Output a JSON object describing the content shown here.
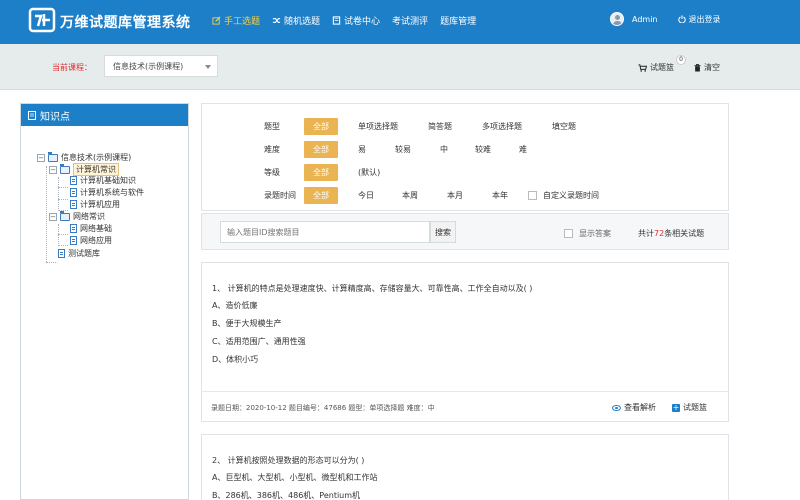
{
  "header": {
    "app_title": "万维试题库管理系统",
    "nav": [
      {
        "label": "手工选题",
        "icon": "edit-icon",
        "active": true
      },
      {
        "label": "随机选题",
        "icon": "shuffle-icon",
        "active": false
      },
      {
        "label": "试卷中心",
        "icon": "book-icon",
        "active": false
      },
      {
        "label": "考试测评",
        "icon": "",
        "active": false
      },
      {
        "label": "题库管理",
        "icon": "",
        "active": false
      }
    ],
    "user": "Admin",
    "logout": "退出登录"
  },
  "subbar": {
    "course_label": "当前课程：",
    "course_value": "信息技术(示例课程)",
    "basket_label": "试题篮",
    "basket_count": "0",
    "clear_label": "清空"
  },
  "knowledge": {
    "title": "知识点",
    "tree": [
      {
        "label": "信息技术(示例课程)"
      },
      {
        "label": "计算机常识"
      },
      {
        "label": "计算机基础知识"
      },
      {
        "label": "计算机系统与软件"
      },
      {
        "label": "计算机应用"
      },
      {
        "label": "网络常识"
      },
      {
        "label": "网络基础"
      },
      {
        "label": "网络应用"
      },
      {
        "label": "测试题库"
      }
    ]
  },
  "filters": {
    "type": {
      "label": "题型",
      "all": "全部",
      "options": [
        "单项选择题",
        "简答题",
        "多项选择题",
        "填空题"
      ]
    },
    "difficulty": {
      "label": "难度",
      "all": "全部",
      "options": [
        "易",
        "较易",
        "中",
        "较难",
        "难"
      ]
    },
    "level": {
      "label": "等级",
      "all": "全部",
      "options": [
        "(默认)"
      ]
    },
    "time": {
      "label": "录题时间",
      "all": "全部",
      "options": [
        "今日",
        "本周",
        "本月",
        "本年"
      ],
      "custom": "自定义录题时间"
    }
  },
  "search": {
    "placeholder": "输入题目ID搜索题目",
    "button": "搜索",
    "show_answer": "显示答案",
    "total_prefix": "共计",
    "total_count": "72",
    "total_suffix": "条相关试题"
  },
  "questions": [
    {
      "stem": "1、 计算机的特点是处理速度快、计算精度高、存储容量大、可靠性高、工作全自动以及(      )",
      "options": [
        "A、造价低廉",
        "B、便于大规模生产",
        "C、适用范围广、通用性强",
        "D、体积小巧"
      ],
      "meta": "录题日期：2020-10-12   题目编号：47686   题型：单项选择题   难度：中",
      "view_label": "查看解析",
      "add_label": "试题篮"
    },
    {
      "stem": "2、 计算机按照处理数据的形态可以分为(      )",
      "options": [
        "A、巨型机、大型机、小型机、微型机和工作站",
        "B、286机、386机、486机、Pentium机"
      ]
    }
  ]
}
